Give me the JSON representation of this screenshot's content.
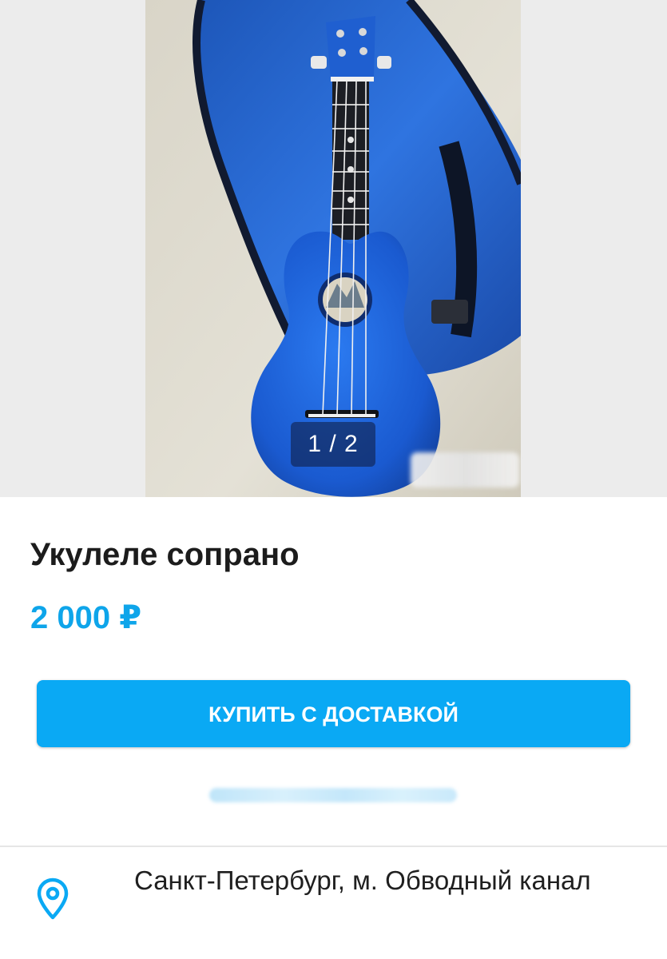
{
  "gallery": {
    "counter": "1 / 2",
    "image_icon": "ukulele-photo",
    "ukulele_color": "#1b5fd1"
  },
  "listing": {
    "title": "Укулеле сопрано",
    "price": "2 000 ₽"
  },
  "actions": {
    "buy_label": "КУПИТЬ С ДОСТАВКОЙ"
  },
  "location": {
    "icon": "map-pin-icon",
    "address": "Санкт-Петербург, м. Обводный канал"
  },
  "colors": {
    "accent": "#0aa9f4",
    "price": "#0ea5ea",
    "text": "#1f1f1f"
  }
}
